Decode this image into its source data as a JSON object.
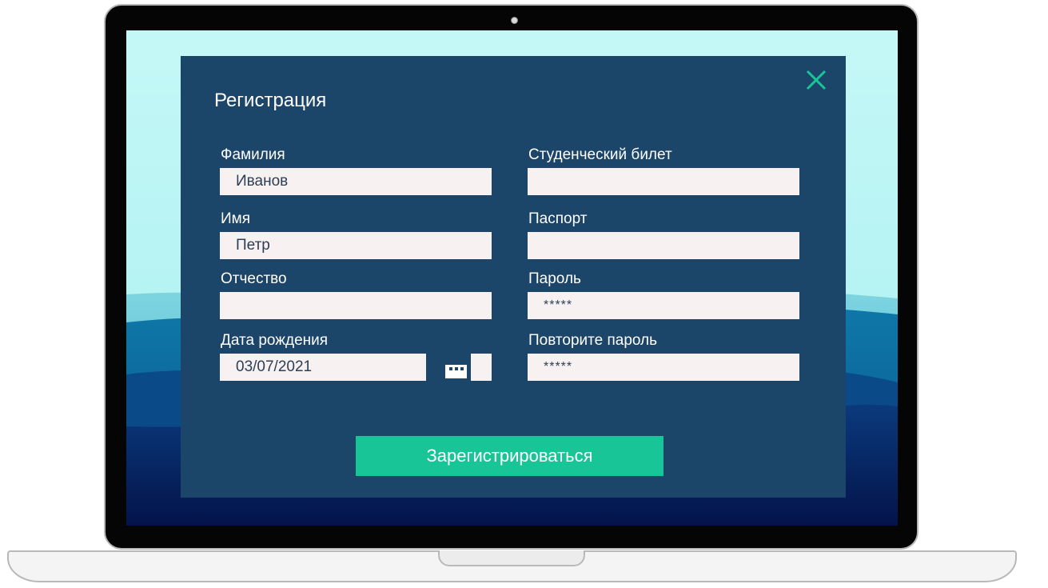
{
  "dialog": {
    "title": "Регистрация",
    "close_icon": "close-icon",
    "accent_color": "#17c596",
    "background_color": "#1c456a"
  },
  "form": {
    "last_name": {
      "label": "Фамилия",
      "value": "Иванов"
    },
    "first_name": {
      "label": "Имя",
      "value": "Петр"
    },
    "middle_name": {
      "label": "Отчество",
      "value": ""
    },
    "birth_date": {
      "label": "Дата рождения",
      "value": "03/07/2021",
      "icon": "calendar-icon"
    },
    "student_id": {
      "label": "Студенческий билет",
      "value": ""
    },
    "passport": {
      "label": "Паспорт",
      "value": ""
    },
    "password": {
      "label": "Пароль",
      "value": "*****"
    },
    "password_repeat": {
      "label": "Повторите пароль",
      "value": "*****"
    }
  },
  "actions": {
    "register_label": "Зарегистрироваться"
  }
}
